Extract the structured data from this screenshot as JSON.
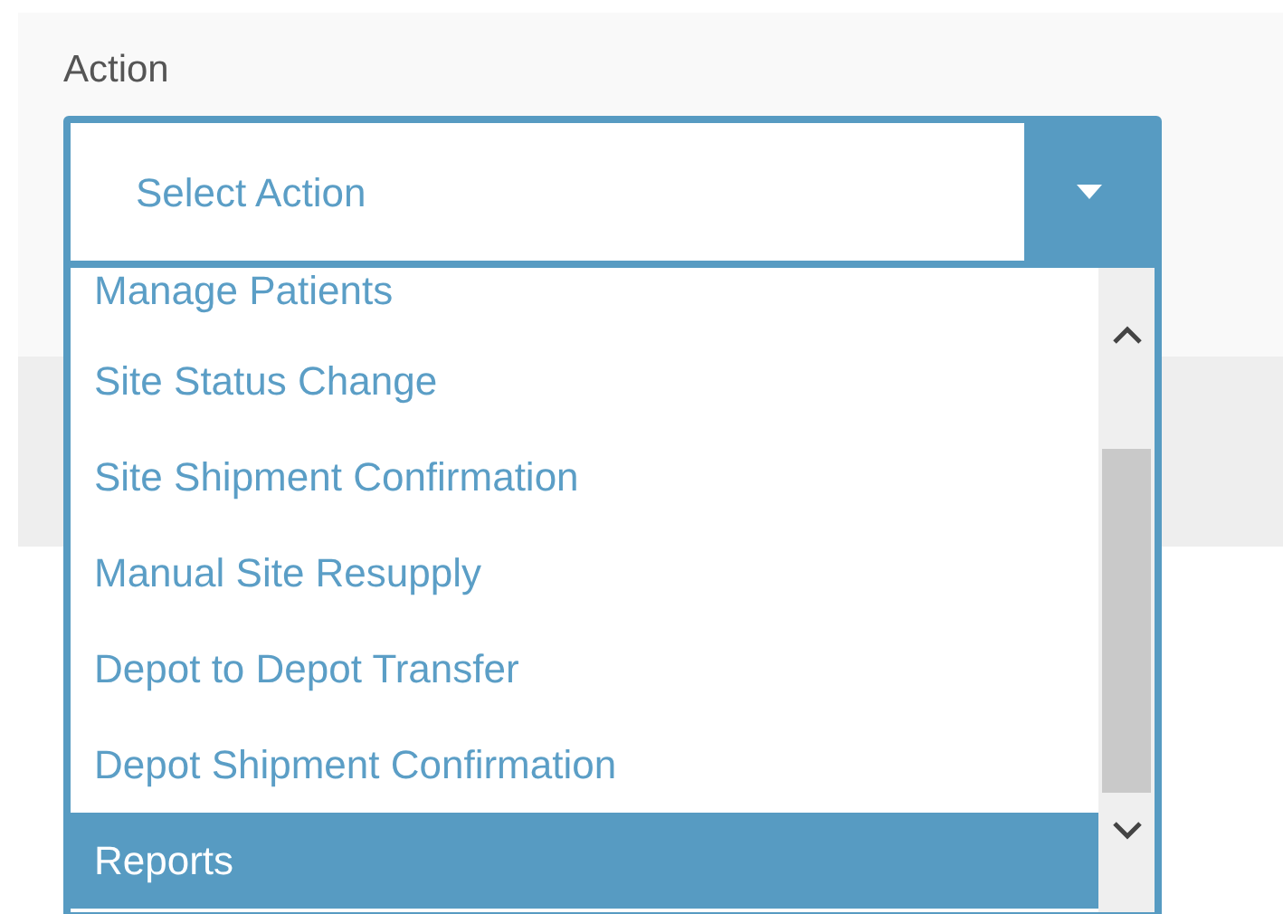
{
  "field": {
    "label": "Action",
    "placeholder": "Select Action",
    "expanded": true
  },
  "options": [
    {
      "label": "Manage Patients",
      "selected": false
    },
    {
      "label": "Site Status Change",
      "selected": false
    },
    {
      "label": "Site Shipment Confirmation",
      "selected": false
    },
    {
      "label": "Manual Site Resupply",
      "selected": false
    },
    {
      "label": "Depot to Depot Transfer",
      "selected": false
    },
    {
      "label": "Depot Shipment Confirmation",
      "selected": false
    },
    {
      "label": "Reports",
      "selected": true
    }
  ]
}
